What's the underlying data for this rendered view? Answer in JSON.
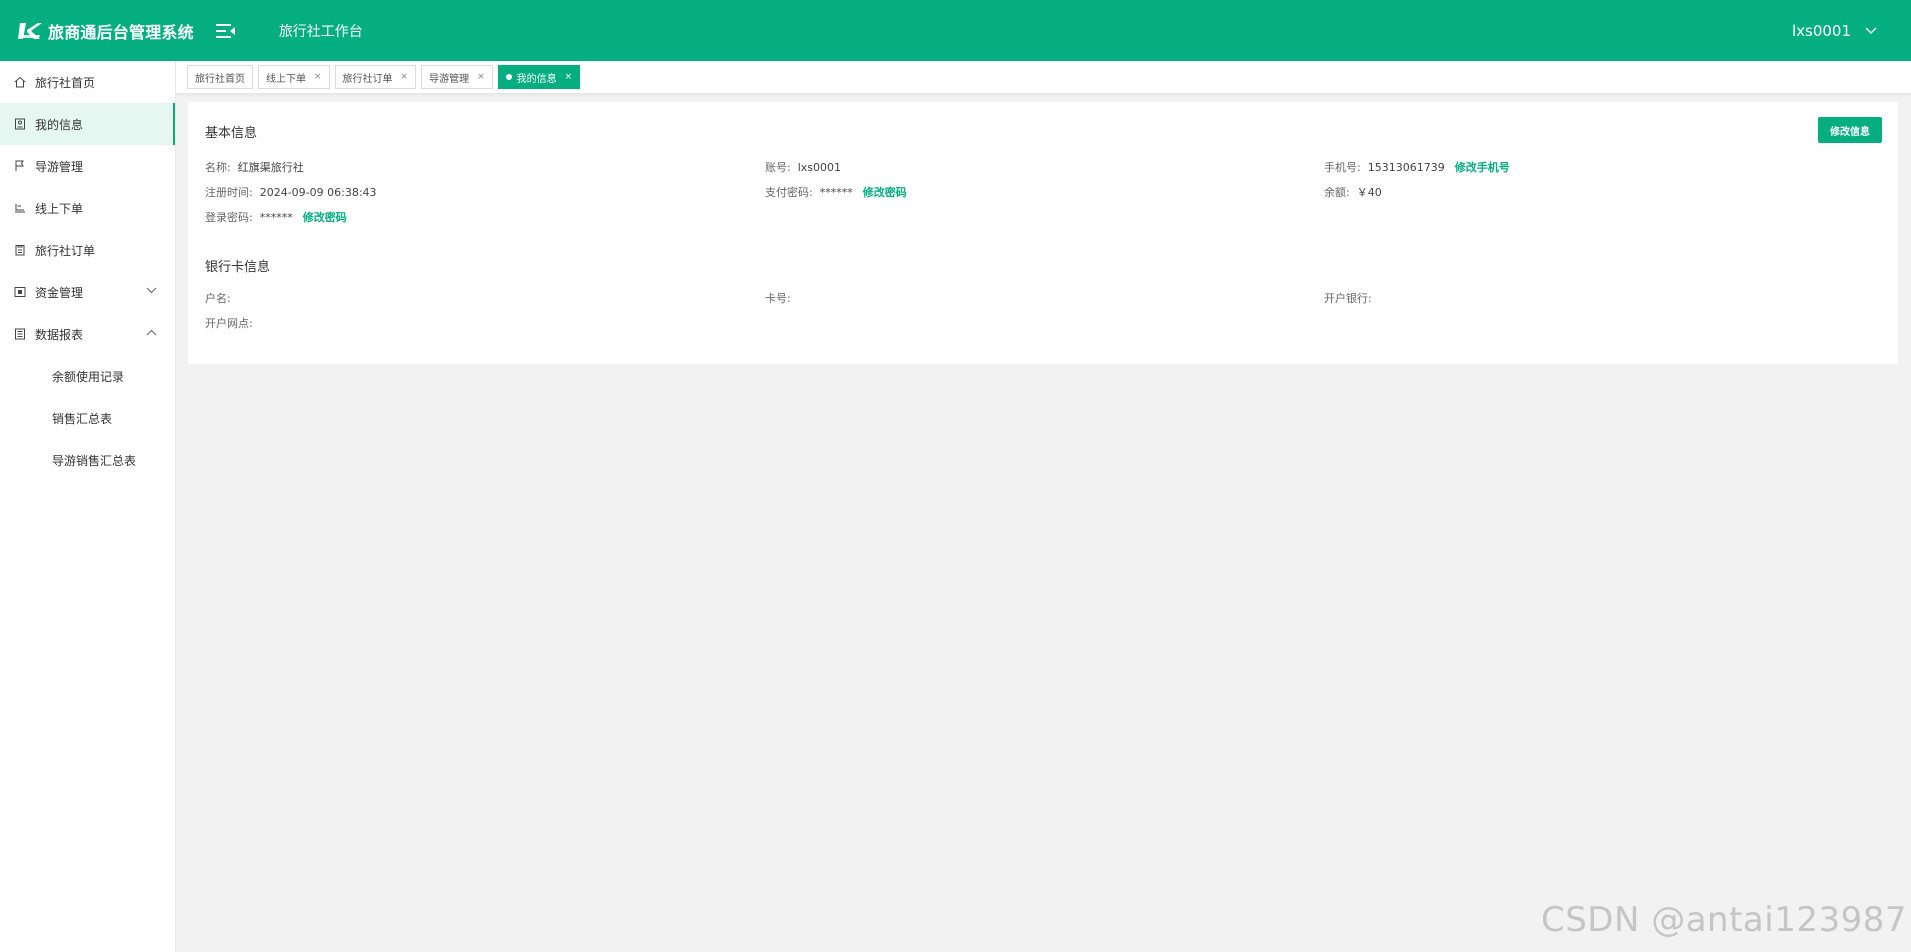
{
  "header": {
    "app_title": "旅商通后台管理系统",
    "workbench": "旅行社工作台",
    "user": "lxs0001"
  },
  "sidebar": {
    "items": [
      {
        "label": "旅行社首页",
        "icon": "home-icon"
      },
      {
        "label": "我的信息",
        "icon": "profile-icon",
        "active": true
      },
      {
        "label": "导游管理",
        "icon": "flag-icon"
      },
      {
        "label": "线上下单",
        "icon": "order-icon"
      },
      {
        "label": "旅行社订单",
        "icon": "clipboard-icon"
      },
      {
        "label": "资金管理",
        "icon": "wallet-icon",
        "expandable": true
      },
      {
        "label": "数据报表",
        "icon": "report-icon",
        "expanded": true
      }
    ],
    "subitems": [
      {
        "label": "余额使用记录"
      },
      {
        "label": "销售汇总表"
      },
      {
        "label": "导游销售汇总表"
      }
    ]
  },
  "tabs": [
    {
      "label": "旅行社首页",
      "closable": false
    },
    {
      "label": "线上下单",
      "closable": true
    },
    {
      "label": "旅行社订单",
      "closable": true
    },
    {
      "label": "导游管理",
      "closable": true
    },
    {
      "label": "我的信息",
      "closable": true,
      "active": true
    }
  ],
  "tab_close_glyph": "×",
  "basic_info": {
    "title": "基本信息",
    "edit_button": "修改信息",
    "name_label": "名称:",
    "name_value": "红旗渠旅行社",
    "account_label": "账号:",
    "account_value": "lxs0001",
    "phone_label": "手机号:",
    "phone_value": "15313061739",
    "phone_link": "修改手机号",
    "reg_time_label": "注册时间:",
    "reg_time_value": "2024-09-09 06:38:43",
    "pay_pwd_label": "支付密码:",
    "pay_pwd_value": "******",
    "pay_pwd_link": "修改密码",
    "balance_label": "余额:",
    "balance_value": "￥40",
    "login_pwd_label": "登录密码:",
    "login_pwd_value": "******",
    "login_pwd_link": "修改密码"
  },
  "bank_info": {
    "title": "银行卡信息",
    "holder_label": "户名:",
    "card_label": "卡号:",
    "bank_label": "开户银行:",
    "branch_label": "开户网点:"
  },
  "watermark": "CSDN @antai123987",
  "colors": {
    "accent": "#05ae80",
    "background": "#f2f2f2"
  }
}
